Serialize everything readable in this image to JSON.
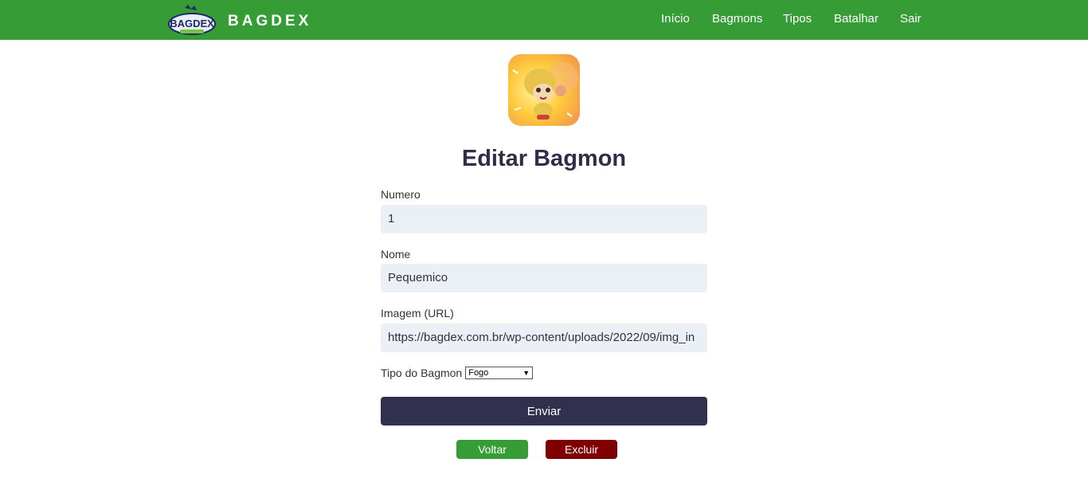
{
  "navbar": {
    "brand": "BAGDEX",
    "logo_text": "BAGDEX",
    "links": [
      "Início",
      "Bagmons",
      "Tipos",
      "Batalhar",
      "Sair"
    ]
  },
  "form": {
    "title": "Editar Bagmon",
    "numero": {
      "label": "Numero",
      "value": "1"
    },
    "nome": {
      "label": "Nome",
      "value": "Pequemico"
    },
    "imagem": {
      "label": "Imagem (URL)",
      "value": "https://bagdex.com.br/wp-content/uploads/2022/09/img_in"
    },
    "tipo": {
      "label": "Tipo do Bagmon",
      "selected": "Fogo"
    },
    "submit_label": "Enviar",
    "back_label": "Voltar",
    "delete_label": "Excluir"
  },
  "colors": {
    "navbar": "#369c35",
    "submit": "#32304f",
    "back": "#369c35",
    "delete": "#7e0000",
    "input_bg": "#ebf0f7"
  }
}
